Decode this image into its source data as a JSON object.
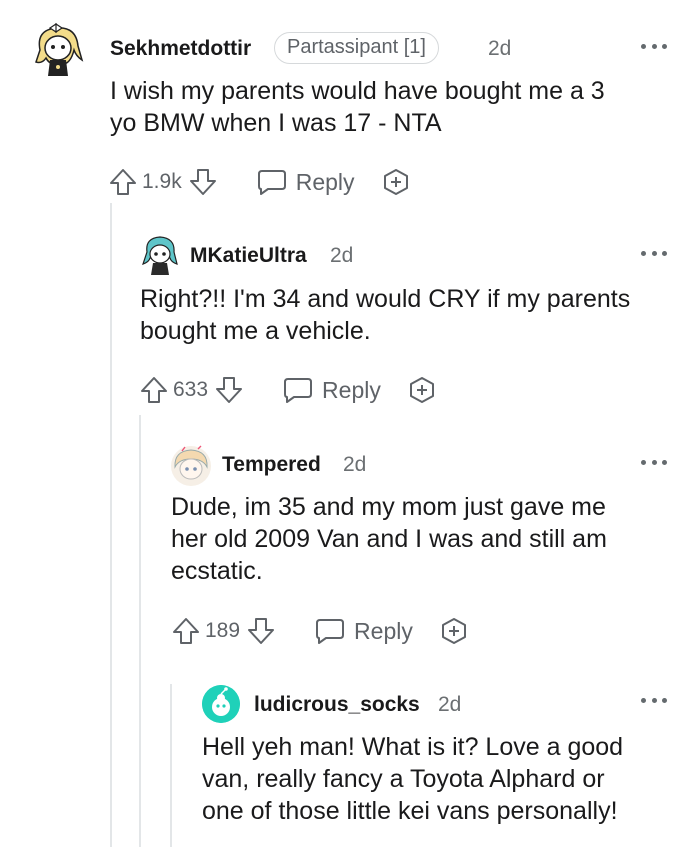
{
  "comments": [
    {
      "username": "Sekhmetdottir",
      "flair": "Partassipant [1]",
      "age": "2d",
      "body": "I wish my parents would have bought me a 3\nyo BMW when I was 17 - NTA",
      "score": "1.9k",
      "reply_label": "Reply"
    },
    {
      "username": "MKatieUltra",
      "age": "2d",
      "body": "Right?!! I'm 34 and would CRY if my parents\nbought me a vehicle.",
      "score": "633",
      "reply_label": "Reply"
    },
    {
      "username": "Tempered",
      "age": "2d",
      "body": "Dude, im 35 and my mom just gave me\nher old 2009 Van and I was and still am\necstatic.",
      "score": "189",
      "reply_label": "Reply"
    },
    {
      "username": "ludicrous_socks",
      "age": "2d",
      "body": "Hell yeh man! What is it? Love a good\nvan, really fancy a Toyota Alphard or\none of those little kei vans personally!"
    }
  ],
  "colors": {
    "text": "#1a1a1b",
    "meta": "#5f6368",
    "thread_line": "#e3e6e8",
    "teal_avatar": "#1fd1b9"
  }
}
